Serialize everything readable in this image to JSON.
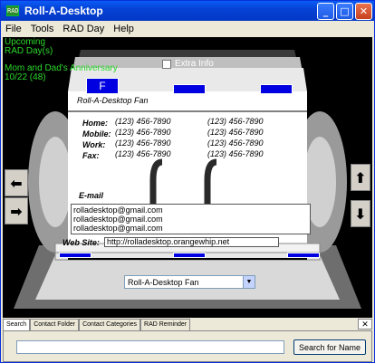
{
  "window": {
    "title": "Roll-A-Desktop",
    "app_icon_text": "RAD"
  },
  "menu": [
    "File",
    "Tools",
    "RAD Day",
    "Help"
  ],
  "upcoming": {
    "line1": "Upcoming",
    "line2": "RAD Day(s)",
    "line3": "Mom and Dad's Anniversary",
    "line4": "10/22 (48)"
  },
  "extra_info_label": "Extra Info",
  "active_tab_letter": "F",
  "card": {
    "name": "Roll-A-Desktop Fan",
    "labels": {
      "home": "Home:",
      "mobile": "Mobile:",
      "work": "Work:",
      "fax": "Fax:",
      "email": "E-mail",
      "website": "Web Site:"
    },
    "phones": {
      "home": [
        "(123) 456-7890",
        "(123) 456-7890"
      ],
      "mobile": [
        "(123) 456-7890",
        "(123) 456-7890"
      ],
      "work": [
        "(123) 456-7890",
        "(123) 456-7890"
      ],
      "fax": [
        "(123) 456-7890",
        "(123) 456-7890"
      ]
    },
    "emails": [
      "rolladesktop@gmail.com",
      "rolladesktop@gmail.com",
      "rolladesktop@gmail.com"
    ],
    "website": "http://rolladesktop.orangewhip.net"
  },
  "contact_select": {
    "value": "Roll-A-Desktop Fan"
  },
  "tabs": [
    "Search",
    "Contact Folder",
    "Contact Categories",
    "RAD Reminder"
  ],
  "active_tab": "Search",
  "search": {
    "value": "",
    "button_label": "Search for Name"
  },
  "colors": {
    "title_bar": "#0542d6",
    "upcoming_text": "#2bd82b",
    "tab_marker": "#0000e0"
  }
}
